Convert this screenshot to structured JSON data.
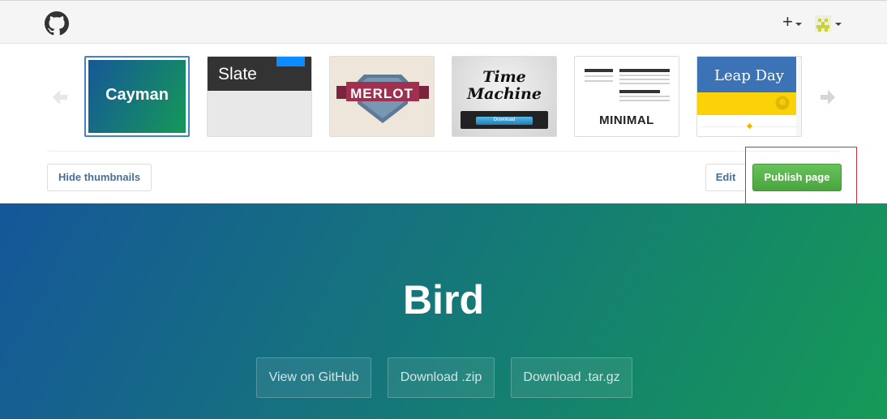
{
  "colors": {
    "accent": "#4183c4",
    "publish_green": "#4ba53f",
    "hero_start": "#155799",
    "hero_end": "#159957",
    "highlight_red": "#cc3333"
  },
  "header": {
    "logo_icon": "github-octocat-icon",
    "new_menu": {
      "label": "+",
      "icon": "plus-icon"
    },
    "user_menu": {
      "icon": "user-avatar-icon"
    }
  },
  "themes": {
    "items": [
      {
        "name": "Cayman",
        "selected": true
      },
      {
        "name": "Slate",
        "selected": false
      },
      {
        "name": "MERLOT",
        "selected": false
      },
      {
        "name_line1": "Time",
        "name_line2": "Machine",
        "download_label": "Download",
        "selected": false
      },
      {
        "name": "MINIMAL",
        "selected": false
      },
      {
        "name": "Leap Day",
        "selected": false
      }
    ]
  },
  "actions": {
    "hide_thumbnails": "Hide thumbnails",
    "edit": "Edit",
    "publish": "Publish page"
  },
  "hero": {
    "project_name": "Bird",
    "buttons": [
      "View on GitHub",
      "Download .zip",
      "Download .tar.gz"
    ]
  }
}
